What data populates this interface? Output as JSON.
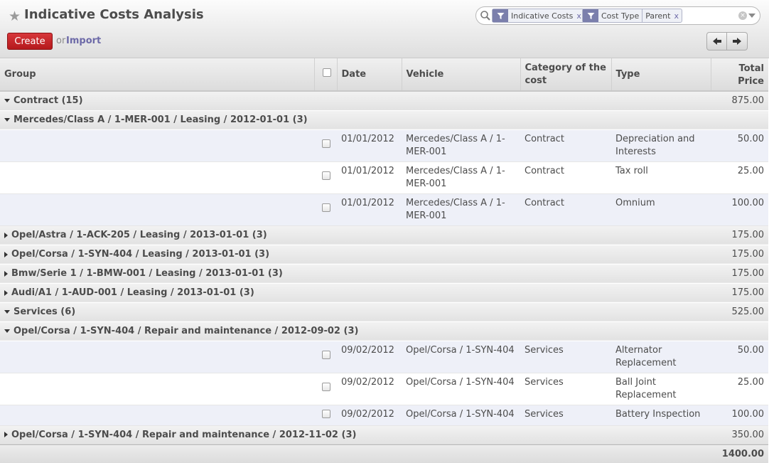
{
  "header": {
    "title": "Indicative Costs Analysis",
    "create_label": "Create",
    "or_label": "or",
    "import_label": "Import"
  },
  "search": {
    "facets": [
      {
        "value": "Indicative Costs"
      },
      {
        "value": "Cost Type",
        "value2": "Parent"
      }
    ],
    "close_glyph": "x"
  },
  "columns": {
    "group": "Group",
    "date": "Date",
    "vehicle": "Vehicle",
    "category": "Category of the cost",
    "type": "Type",
    "total": "Total Price"
  },
  "groups": {
    "contract": {
      "label": "Contract (15)",
      "total": "875.00"
    },
    "mercedes": {
      "label": "Mercedes/Class A / 1-MER-001 / Leasing / 2012-01-01 (3)"
    },
    "opel_astra": {
      "label": "Opel/Astra / 1-ACK-205 / Leasing / 2013-01-01 (3)",
      "total": "175.00"
    },
    "opel_corsa": {
      "label": "Opel/Corsa / 1-SYN-404 / Leasing / 2013-01-01 (3)",
      "total": "175.00"
    },
    "bmw": {
      "label": "Bmw/Serie 1 / 1-BMW-001 / Leasing / 2013-01-01 (3)",
      "total": "175.00"
    },
    "audi": {
      "label": "Audi/A1 / 1-AUD-001 / Leasing / 2013-01-01 (3)",
      "total": "175.00"
    },
    "services": {
      "label": "Services (6)",
      "total": "525.00"
    },
    "corsa_repair_1": {
      "label": "Opel/Corsa / 1-SYN-404 / Repair and maintenance / 2012-09-02 (3)"
    },
    "corsa_repair_2": {
      "label": "Opel/Corsa / 1-SYN-404 / Repair and maintenance / 2012-11-02 (3)",
      "total": "350.00"
    }
  },
  "rows": {
    "r1": {
      "date": "01/01/2012",
      "vehicle": "Mercedes/Class A / 1-MER-001",
      "category": "Contract",
      "type": "Depreciation and Interests",
      "total": "50.00"
    },
    "r2": {
      "date": "01/01/2012",
      "vehicle": "Mercedes/Class A / 1-MER-001",
      "category": "Contract",
      "type": "Tax roll",
      "total": "25.00"
    },
    "r3": {
      "date": "01/01/2012",
      "vehicle": "Mercedes/Class A / 1-MER-001",
      "category": "Contract",
      "type": "Omnium",
      "total": "100.00"
    },
    "r4": {
      "date": "09/02/2012",
      "vehicle": "Opel/Corsa / 1-SYN-404",
      "category": "Services",
      "type": "Alternator Replacement",
      "total": "50.00"
    },
    "r5": {
      "date": "09/02/2012",
      "vehicle": "Opel/Corsa / 1-SYN-404",
      "category": "Services",
      "type": "Ball Joint Replacement",
      "total": "25.00"
    },
    "r6": {
      "date": "09/02/2012",
      "vehicle": "Opel/Corsa / 1-SYN-404",
      "category": "Services",
      "type": "Battery Inspection",
      "total": "100.00"
    }
  },
  "grand_total": "1400.00",
  "icons": {
    "favorite": "star-icon",
    "search": "search-icon",
    "facet": "filter-icon",
    "clear": "clear-icon",
    "dropdown": "chevron-down-icon",
    "prev": "arrow-left-icon",
    "next": "arrow-right-icon"
  },
  "colors": {
    "create_button": "#c1272b",
    "link": "#6d6aa8",
    "facet_category": "#7b7fac",
    "odd_row": "#eef0f8"
  }
}
